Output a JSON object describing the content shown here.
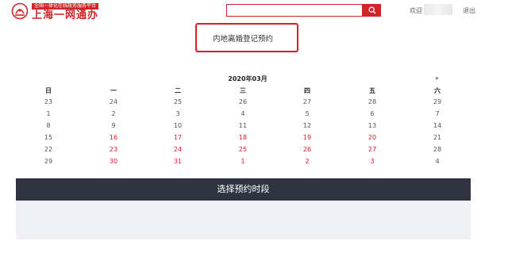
{
  "brand": {
    "subtitle": "全国一体化在线政务服务平台",
    "name": "上海一网通办",
    "color": "#d0262a"
  },
  "search": {
    "placeholder": "",
    "icon": "search-icon"
  },
  "user": {
    "welcome": "欢迎",
    "logout": "退出"
  },
  "service": {
    "title": "内地离婚登记预约"
  },
  "calendar": {
    "month": "2020年03月",
    "next": "»",
    "weekdays": [
      "日",
      "一",
      "二",
      "三",
      "四",
      "五",
      "六"
    ],
    "weeks": [
      [
        "23",
        "24",
        "25",
        "26",
        "27",
        "28",
        "29"
      ],
      [
        "1",
        "2",
        "3",
        "4",
        "5",
        "6",
        "7"
      ],
      [
        "8",
        "9",
        "10",
        "11",
        "12",
        "13",
        "14"
      ],
      [
        "15",
        "16",
        "17",
        "18",
        "19",
        "20",
        "21"
      ],
      [
        "22",
        "23",
        "24",
        "25",
        "26",
        "27",
        "28"
      ],
      [
        "29",
        "30",
        "31",
        "1",
        "2",
        "3",
        "4"
      ]
    ],
    "available": [
      [
        false,
        false,
        false,
        false,
        false,
        false,
        false
      ],
      [
        false,
        false,
        false,
        false,
        false,
        false,
        false
      ],
      [
        false,
        false,
        false,
        false,
        false,
        false,
        false
      ],
      [
        false,
        true,
        true,
        true,
        true,
        true,
        false
      ],
      [
        false,
        true,
        true,
        true,
        true,
        true,
        false
      ],
      [
        false,
        true,
        true,
        true,
        true,
        true,
        false
      ]
    ],
    "available_color": "#e0192c"
  },
  "slots": {
    "title": "选择预约时段"
  }
}
